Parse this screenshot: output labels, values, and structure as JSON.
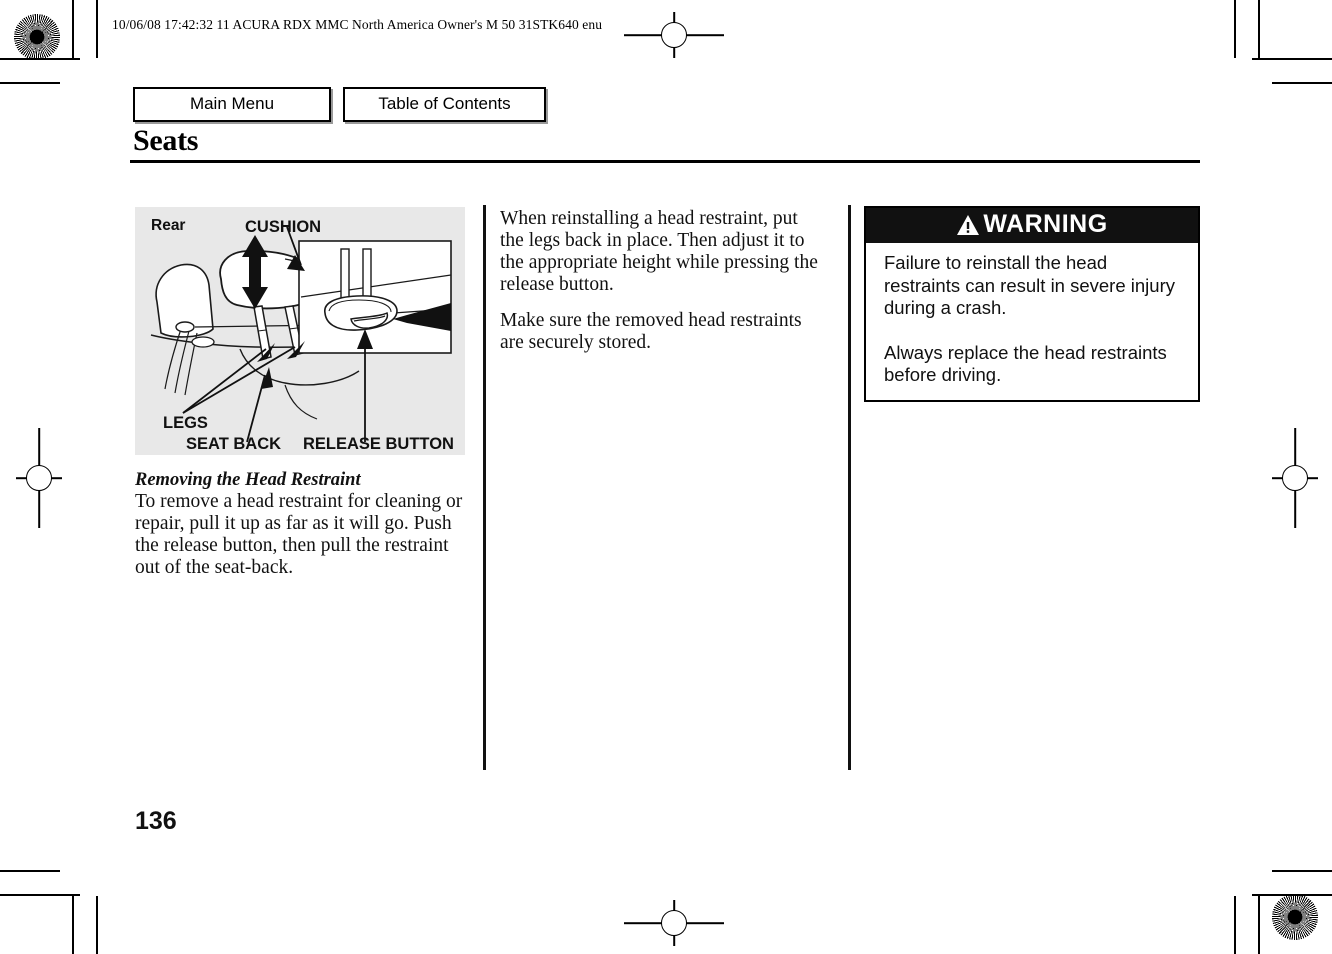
{
  "document": {
    "header_line": "10/06/08 17:42:32   11 ACURA RDX MMC North America Owner's M 50 31STK640 enu",
    "page_title": "Seats",
    "page_number": "136"
  },
  "nav": {
    "main_menu_label": "Main Menu",
    "table_of_contents_label": "Table of Contents"
  },
  "figure": {
    "labels": {
      "rear": "Rear",
      "cushion": "CUSHION",
      "legs": "LEGS",
      "seat_back": "SEAT BACK",
      "release_button": "RELEASE BUTTON"
    },
    "background_color": "#e8e8e8"
  },
  "left_column": {
    "section_heading": "Removing the Head Restraint",
    "body": "To remove a head restraint for cleaning or repair, pull it up as far as it will go. Push the release button, then pull the restraint out of the seat-back."
  },
  "middle_column": {
    "paragraph1": "When reinstalling a head restraint, put the legs back in place. Then adjust it to the appropriate height while pressing the release button.",
    "paragraph2": "Make sure the removed head restraints are securely stored."
  },
  "warning": {
    "title": "WARNING",
    "icon": "warning-triangle-icon",
    "paragraph1": "Failure to reinstall the head restraints can result in severe injury during a crash.",
    "paragraph2": "Always replace the head restraints before driving.",
    "header_background": "#111111",
    "header_color": "#ffffff"
  }
}
